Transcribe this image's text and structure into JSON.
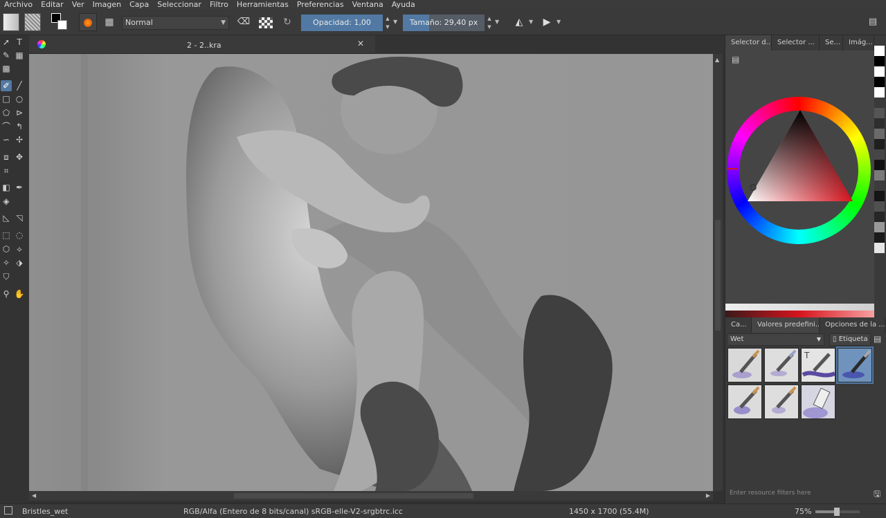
{
  "menu": [
    "Archivo",
    "Editar",
    "Ver",
    "Imagen",
    "Capa",
    "Seleccionar",
    "Filtro",
    "Herramientas",
    "Preferencias",
    "Ventana",
    "Ayuda"
  ],
  "toolbar": {
    "blend_mode": "Normal",
    "opacity_label": "Opacidad:  1,00",
    "opacity_value": 1.0,
    "size_label": "Tamaño:  29,40 px",
    "size_fraction": 0.32
  },
  "document": {
    "tab_title": "2 - 2..kra"
  },
  "docker": {
    "tabs": [
      "Selector d...",
      "Selector ...",
      "Se...",
      "Imág..."
    ],
    "color_main": "#d6141e",
    "palette": [
      "#ffffff",
      "#000000",
      "#ffffff",
      "#000000",
      "#ffffff",
      "#3a3a3a",
      "#555555",
      "#2e2e2e",
      "#6a6a6a",
      "#1f1f1f",
      "#464646",
      "#111111",
      "#7a7a7a",
      "#3c3c3c",
      "#151515",
      "#505050",
      "#262626",
      "#999999",
      "#1a1a1a",
      "#e6e6e6"
    ]
  },
  "presets_panel": {
    "tabs": [
      "Ca...",
      "Valores predefini...",
      "Opciones de la ..."
    ],
    "category": "Wet",
    "tag_label": "Etiqueta",
    "filter_placeholder": "Enter resource filters here"
  },
  "status": {
    "brush": "Bristles_wet",
    "color_profile": "RGB/Alfa (Entero de 8 bits/canal)  sRGB-elle-V2-srgbtrc.icc",
    "dimensions": "1450 x 1700 (55.4M)",
    "zoom": "75%",
    "zoom_fraction": 0.48
  },
  "colors": {
    "accent": "#5279a3",
    "panel": "#3a3a3a"
  }
}
